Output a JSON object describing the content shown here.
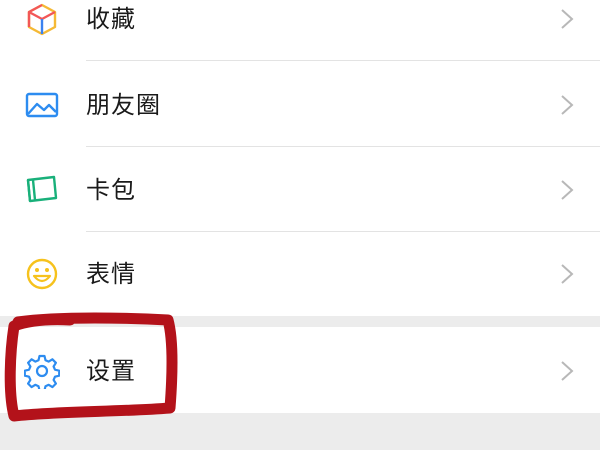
{
  "menu": {
    "items": [
      {
        "label": "收藏",
        "icon": "favorites-cube-icon"
      },
      {
        "label": "朋友圈",
        "icon": "moments-picture-icon"
      },
      {
        "label": "卡包",
        "icon": "card-wallet-icon"
      },
      {
        "label": "表情",
        "icon": "sticker-smile-icon"
      }
    ],
    "settings": {
      "label": "设置",
      "icon": "gear-icon"
    }
  },
  "colors": {
    "background": "#ececec",
    "row_background": "#ffffff",
    "text": "#1a1a1a",
    "chevron": "#b8b8b8",
    "highlight_annotation": "#b3121a",
    "favorites_icon": [
      "#f25757",
      "#f5b935",
      "#3b82f0"
    ],
    "moments_icon": "#2d8cf0",
    "card_icon": "#19b07a",
    "sticker_icon": "#f6c21d",
    "settings_icon": "#2d8cf0"
  }
}
